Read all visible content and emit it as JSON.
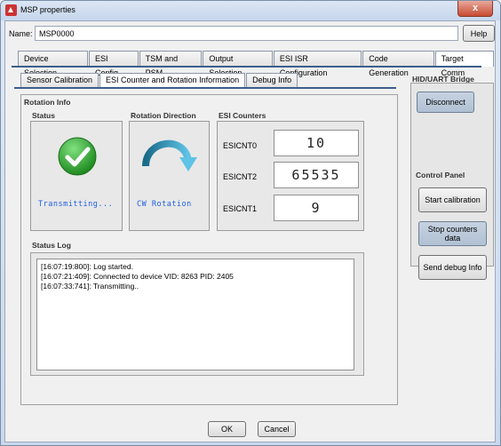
{
  "window": {
    "title": "MSP properties",
    "close_symbol": "x"
  },
  "name_field": {
    "label": "Name:",
    "value": "MSP0000"
  },
  "help_label": "Help",
  "tabs": [
    {
      "label": "Device Selection"
    },
    {
      "label": "ESI Config"
    },
    {
      "label": "TSM and PSM"
    },
    {
      "label": "Output Selection"
    },
    {
      "label": "ESI ISR Configuration"
    },
    {
      "label": "Code Generation"
    },
    {
      "label": "Target Comm",
      "active": true
    }
  ],
  "subtabs": [
    {
      "label": "Sensor Calibration"
    },
    {
      "label": "ESI Counter and Rotation Information",
      "active": true
    },
    {
      "label": "Debug Info"
    }
  ],
  "rotation_info": {
    "title": "Rotation Info",
    "status_title": "Status",
    "status_text": "Transmitting...",
    "direction_title": "Rotation Direction",
    "direction_text": "CW Rotation",
    "counters_title": "ESI Counters",
    "counters": [
      {
        "label": "ESICNT0",
        "value": "10"
      },
      {
        "label": "ESICNT2",
        "value": "65535"
      },
      {
        "label": "ESICNT1",
        "value": "9"
      }
    ]
  },
  "status_log": {
    "title": "Status Log",
    "lines": [
      "[16:07:19:800]: Log started.",
      "[16:07:21:409]: Connected to device VID: 8263 PID: 2405",
      "[16:07:33:741]: Transmitting.."
    ]
  },
  "hid_bridge": {
    "title": "HID/UART Bridge",
    "disconnect_label": "Disconnect"
  },
  "control_panel": {
    "title": "Control Panel",
    "buttons": [
      {
        "label": "Start calibration"
      },
      {
        "label": "Stop counters data",
        "pressed": true
      },
      {
        "label": "Send debug Info"
      }
    ]
  },
  "footer": {
    "ok_label": "OK",
    "cancel_label": "Cancel"
  },
  "colors": {
    "accent_tab_line": "#3c5e8c",
    "status_text": "#1f5fe0",
    "check_green": "#2aa02a",
    "arrow_start": "#1a6b8a",
    "arrow_end": "#5fc3e6"
  }
}
